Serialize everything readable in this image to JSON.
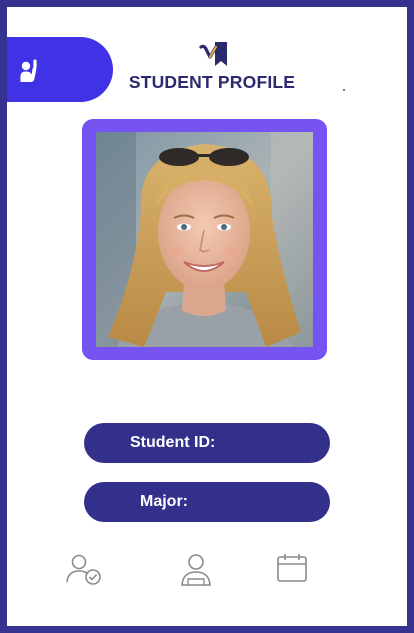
{
  "header": {
    "title": "STUDENT PROFILE",
    "logo_icon": "v-bookmark-logo-icon",
    "side_button_icon": "raise-hand-icon"
  },
  "profile": {
    "photo_description_icon": "student-photo"
  },
  "fields": {
    "student_id_label": "Student ID:",
    "major_label": "Major:"
  },
  "nav": {
    "items": [
      {
        "icon": "user-check-icon"
      },
      {
        "icon": "student-profile-icon"
      },
      {
        "icon": "calendar-icon"
      }
    ]
  },
  "colors": {
    "frame_border": "#35338f",
    "accent_blue": "#4033e6",
    "photo_border": "#7654f2",
    "pill_fill": "#33308c",
    "title_text": "#2c2a6e",
    "logo_gold": "#e8b23a"
  }
}
